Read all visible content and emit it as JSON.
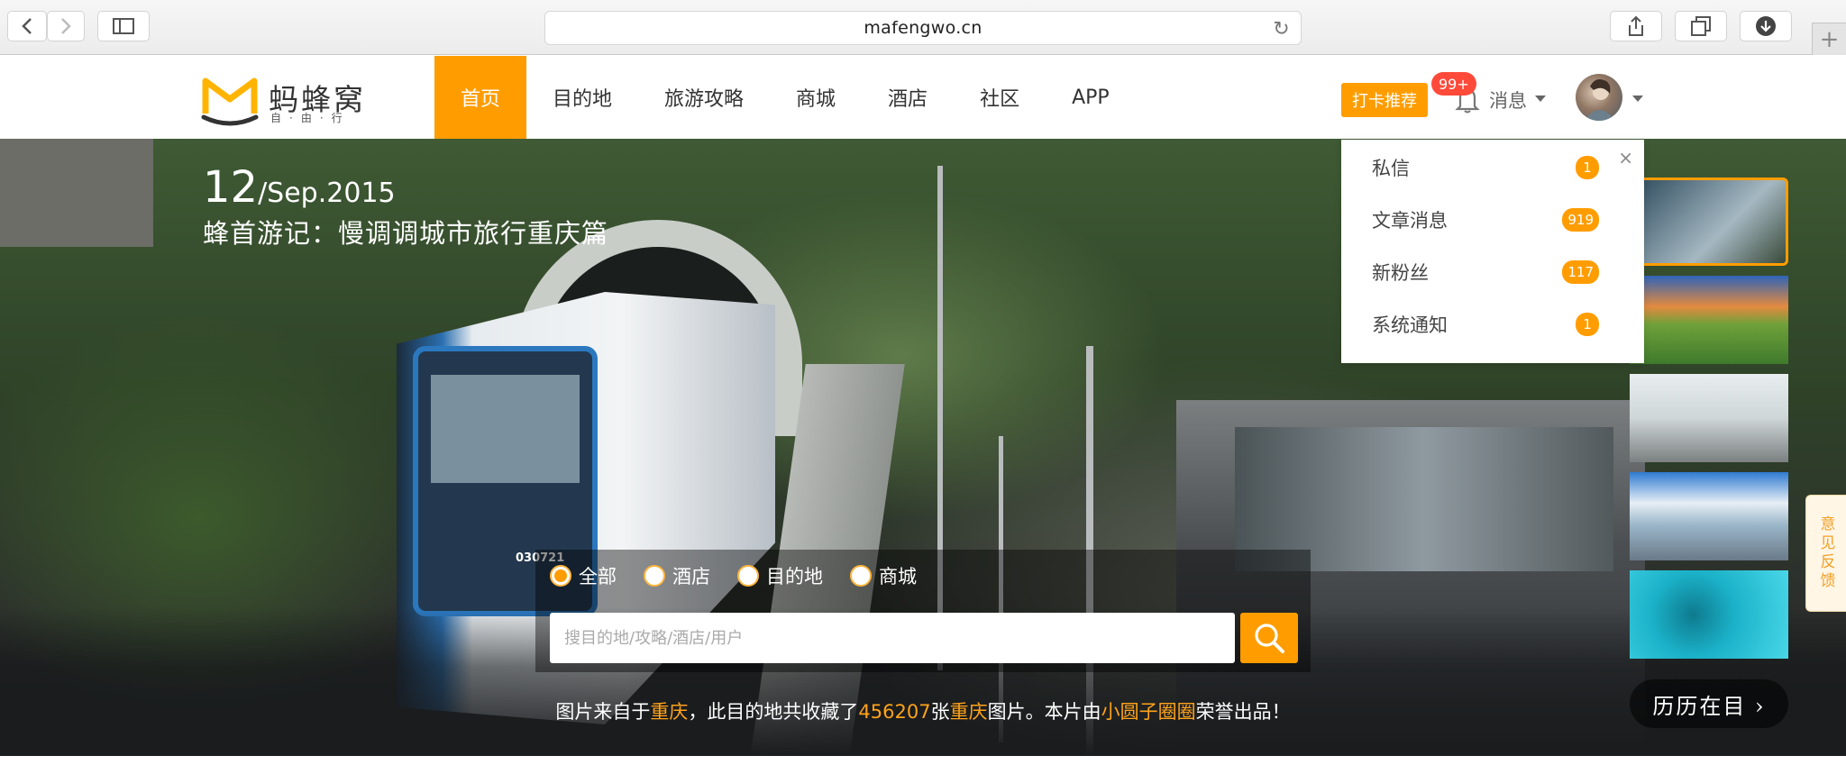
{
  "browser": {
    "url": "mafengwo.cn",
    "icons": [
      "back-icon",
      "forward-icon",
      "sidebar-icon",
      "reload-icon",
      "share-icon",
      "tabs-icon",
      "download-icon",
      "new-tab-icon"
    ]
  },
  "header": {
    "logo_text": "蚂蜂窝",
    "logo_sub": "自·由·行",
    "nav": [
      "首页",
      "目的地",
      "旅游攻略",
      "商城",
      "酒店",
      "社区",
      "APP"
    ],
    "active_nav": "首页",
    "checkin_label": "打卡推荐",
    "notif_badge": "99+",
    "messages_label": "消息"
  },
  "messages_dropdown": {
    "close_symbol": "×",
    "items": [
      {
        "label": "私信",
        "count": "1"
      },
      {
        "label": "文章消息",
        "count": "919"
      },
      {
        "label": "新粉丝",
        "count": "117"
      },
      {
        "label": "系统通知",
        "count": "1"
      }
    ]
  },
  "hero": {
    "date_day": "12",
    "date_rest": "/Sep.2015",
    "subtitle": "蜂首游记：慢调调城市旅行重庆篇",
    "history_label": "历历在目 ›",
    "feedback_label": "意见反馈"
  },
  "search": {
    "options": [
      {
        "label": "全部",
        "selected": true
      },
      {
        "label": "酒店",
        "selected": false
      },
      {
        "label": "目的地",
        "selected": false
      },
      {
        "label": "商城",
        "selected": false
      }
    ],
    "placeholder": "搜目的地/攻略/酒店/用户"
  },
  "credit": {
    "prefix": "图片来自于",
    "place": "重庆",
    "middle": "，此目的地共收藏了",
    "count": "456207",
    "unit": "张",
    "place2": "重庆",
    "middle2": "图片。本片由",
    "author": "小圆子圈圈",
    "suffix": "荣誉出品！"
  },
  "colors": {
    "accent": "#ff9d00",
    "badge_red": "#ff4a3a",
    "highlight": "#ffa31a"
  }
}
